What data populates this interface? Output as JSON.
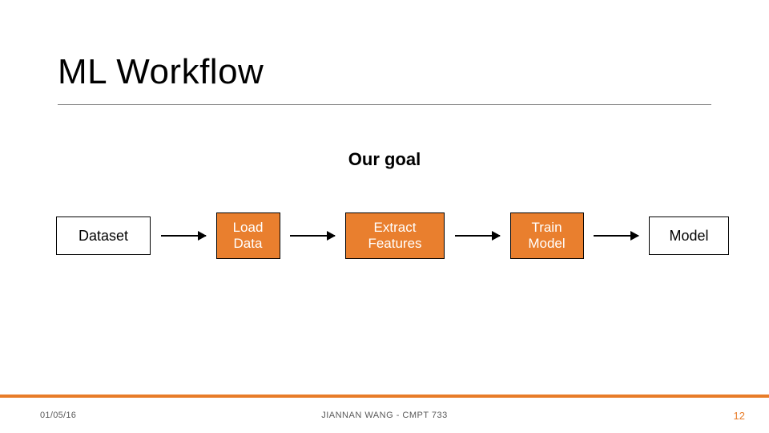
{
  "title": "ML Workflow",
  "subtitle": "Our  goal",
  "flow": {
    "dataset": "Dataset",
    "load": "Load\nData",
    "extract": "Extract\nFeatures",
    "train": "Train\nModel",
    "model": "Model"
  },
  "footer": {
    "date": "01/05/16",
    "center": "JIANNAN WANG - CMPT 733",
    "page": "12"
  },
  "colors": {
    "accent": "#e87c28",
    "box_fill": "#e97f2e"
  }
}
